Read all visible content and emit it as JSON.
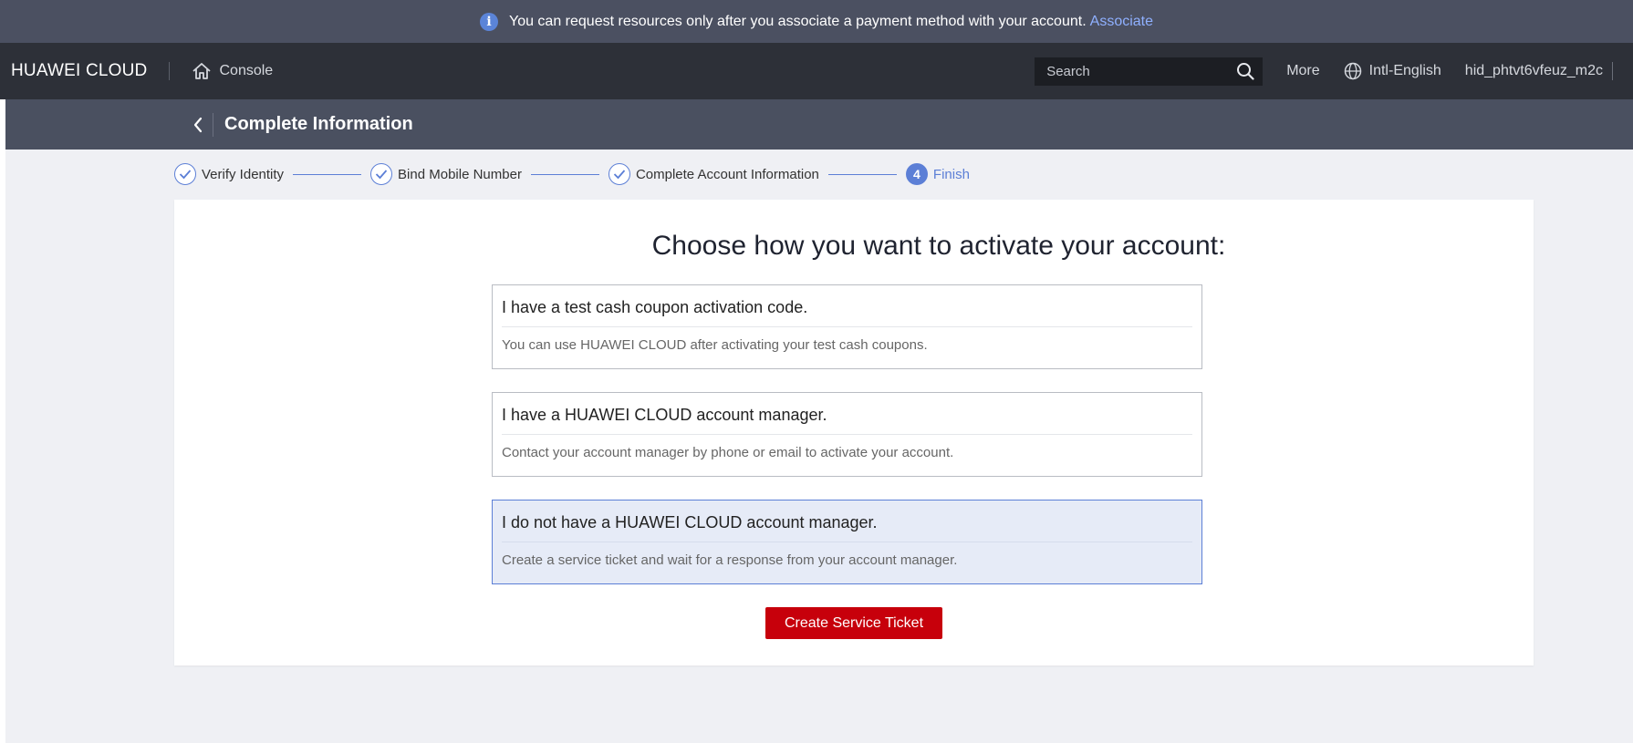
{
  "notice": {
    "message": "You can request resources only after you associate a payment method with your account.",
    "link_label": "Associate",
    "icon": "info-icon"
  },
  "topnav": {
    "brand": "HUAWEI CLOUD",
    "console_label": "Console",
    "search_placeholder": "Search",
    "more_label": "More",
    "language_label": "Intl-English",
    "username": "hid_phtvt6vfeuz_m2c"
  },
  "page": {
    "title": "Complete Information"
  },
  "steps": [
    {
      "label": "Verify Identity",
      "status": "done"
    },
    {
      "label": "Bind Mobile Number",
      "status": "done"
    },
    {
      "label": "Complete Account Information",
      "status": "done"
    },
    {
      "label": "Finish",
      "number": "4",
      "status": "active"
    }
  ],
  "main": {
    "heading": "Choose how you want to activate your account:",
    "options": [
      {
        "title": "I have a test cash coupon activation code.",
        "description": "You can use HUAWEI CLOUD after activating your test cash coupons.",
        "selected": false
      },
      {
        "title": "I have a HUAWEI CLOUD account manager.",
        "description": "Contact your account manager by phone or email to activate your account.",
        "selected": false
      },
      {
        "title": "I do not have a HUAWEI CLOUD account manager.",
        "description": "Create a service ticket and wait for a response from your account manager.",
        "selected": true
      }
    ],
    "button_label": "Create Service Ticket"
  },
  "colors": {
    "accent": "#5c7fd6",
    "primary_button": "#c7000b",
    "notice_bg": "#4b5061",
    "nav_bg": "#2d3038"
  }
}
